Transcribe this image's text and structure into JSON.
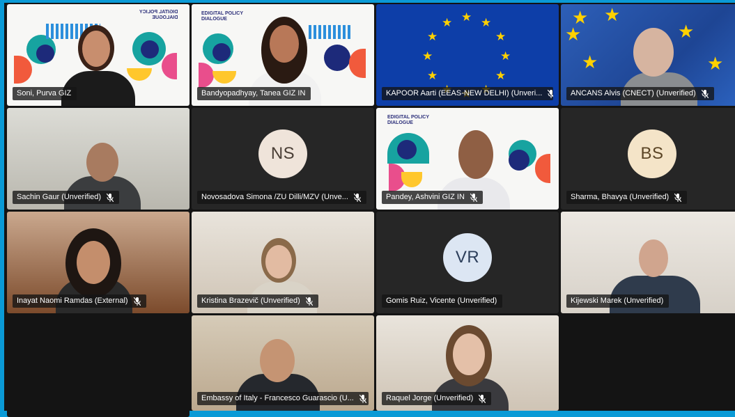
{
  "participants": [
    {
      "name": "Soni, Purva GIZ",
      "muted": false,
      "display": "video"
    },
    {
      "name": "Bandyopadhyay, Tanea GIZ IN",
      "muted": false,
      "display": "video"
    },
    {
      "name": "KAPOOR Aarti (EEAS-NEW DELHI) (Unveri...",
      "muted": true,
      "display": "eu-flag"
    },
    {
      "name": "ANCANS Alvis (CNECT) (Unverified)",
      "muted": true,
      "display": "video"
    },
    {
      "name": "Sachin Gaur (Unverified)",
      "muted": true,
      "display": "video"
    },
    {
      "name": "Novosadova Simona /ZU Dilli/MZV (Unve...",
      "muted": true,
      "display": "avatar",
      "initials": "NS"
    },
    {
      "name": "Pandey, Ashvini GIZ IN",
      "muted": true,
      "display": "video"
    },
    {
      "name": "Sharma, Bhavya (Unverified)",
      "muted": true,
      "display": "avatar",
      "initials": "BS"
    },
    {
      "name": "Inayat Naomi Ramdas (External)",
      "muted": true,
      "display": "video"
    },
    {
      "name": "Kristina Brazevič (Unverified)",
      "muted": true,
      "display": "video"
    },
    {
      "name": "Gomis Ruiz, Vicente (Unverified)",
      "muted": false,
      "display": "avatar",
      "initials": "VR"
    },
    {
      "name": "Kijewski Marek (Unverified)",
      "muted": false,
      "display": "video"
    },
    {
      "name": "Embassy of Italy - Francesco Guarascio (U...",
      "muted": true,
      "display": "video"
    },
    {
      "name": "Raquel Jorge (Unverified)",
      "muted": true,
      "display": "video"
    }
  ],
  "branding": {
    "dpd_line1": "EDIGITAL POLICY",
    "dpd_line2": "DIALOGUE",
    "dpd_mirrored_1": "DIGITAL POLICY",
    "dpd_mirrored_2": "DIALOGUE"
  },
  "colors": {
    "eu_blue": "#0d3ea8",
    "eu_star": "#ffd100",
    "frame_border": "#0a9ad6",
    "nametag_bg": "#141414"
  }
}
